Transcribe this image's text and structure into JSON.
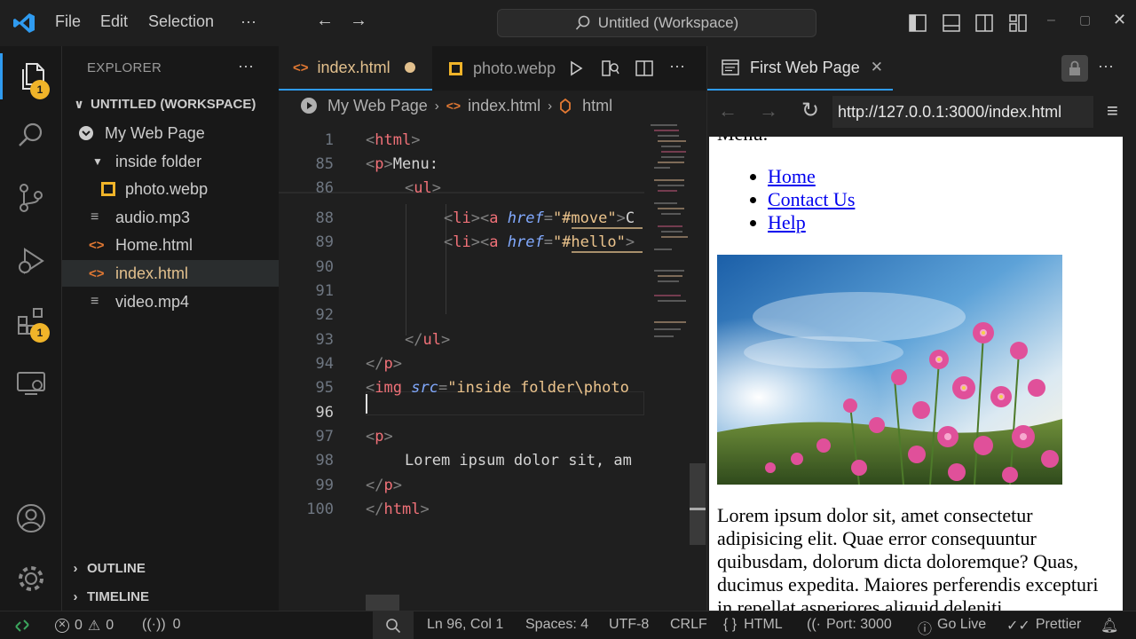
{
  "menu": {
    "file": "File",
    "edit": "Edit",
    "selection": "Selection",
    "more": "···"
  },
  "search": {
    "text": "Untitled (Workspace)"
  },
  "activity": {
    "explorer_badge": "1",
    "extensions_badge": "1"
  },
  "sidebar": {
    "title": "EXPLORER",
    "more": "···",
    "workspace": "UNTITLED (WORKSPACE)",
    "items": [
      {
        "label": "My Web Page",
        "type": "folder-root"
      },
      {
        "label": "inside folder",
        "type": "folder"
      },
      {
        "label": "photo.webp",
        "type": "image"
      },
      {
        "label": "audio.mp3",
        "type": "file"
      },
      {
        "label": "Home.html",
        "type": "html"
      },
      {
        "label": "index.html",
        "type": "html",
        "active": true
      },
      {
        "label": "video.mp4",
        "type": "file"
      }
    ],
    "outline": "OUTLINE",
    "timeline": "TIMELINE"
  },
  "editor": {
    "tabs": [
      {
        "label": "index.html",
        "active": true,
        "modified": true
      },
      {
        "label": "photo.webp",
        "active": false
      }
    ],
    "breadcrumb": [
      "My Web Page",
      "index.html",
      "html"
    ],
    "lines": [
      {
        "num": "1",
        "indent": 0,
        "code": "<html>"
      },
      {
        "num": "85",
        "indent": 0,
        "code": "<p>Menu:"
      },
      {
        "num": "86",
        "indent": 1,
        "code": "<ul>"
      },
      {
        "num": "88",
        "indent": 2,
        "code": "<li><a href=\"#move\">C"
      },
      {
        "num": "89",
        "indent": 2,
        "code": "<li><a href=\"#hello\">"
      },
      {
        "num": "90",
        "indent": 0,
        "code": ""
      },
      {
        "num": "91",
        "indent": 0,
        "code": ""
      },
      {
        "num": "92",
        "indent": 0,
        "code": ""
      },
      {
        "num": "93",
        "indent": 1,
        "code": "</ul>"
      },
      {
        "num": "94",
        "indent": 0,
        "code": "</p>"
      },
      {
        "num": "95",
        "indent": 0,
        "code": "<img src=\"inside folder\\photo"
      },
      {
        "num": "96",
        "indent": 0,
        "code": "",
        "current": true
      },
      {
        "num": "97",
        "indent": 0,
        "code": "<p>"
      },
      {
        "num": "98",
        "indent": 1,
        "code": "Lorem ipsum dolor sit, am"
      },
      {
        "num": "99",
        "indent": 0,
        "code": "</p>"
      },
      {
        "num": "100",
        "indent": 0,
        "code": "</html>"
      }
    ]
  },
  "browser": {
    "tab_title": "First Web Page",
    "url": "http://127.0.0.1:3000/index.html",
    "partial_heading": "Menu:",
    "links": [
      "Home",
      "Contact Us",
      "Help"
    ],
    "paragraph": "Lorem ipsum dolor sit, amet consectetur adipisicing elit. Quae error consequuntur quibusdam, dolorum dicta doloremque? Quas, ducimus expedita. Maiores perferendis excepturi in repellat asperiores aliquid deleniti"
  },
  "status": {
    "errors": "0",
    "warnings": "0",
    "ports": "0",
    "position": "Ln 96, Col 1",
    "spaces": "Spaces: 4",
    "encoding": "UTF-8",
    "eol": "CRLF",
    "language": "HTML",
    "port": "Port: 3000",
    "golive": "Go Live",
    "prettier": "Prettier"
  }
}
